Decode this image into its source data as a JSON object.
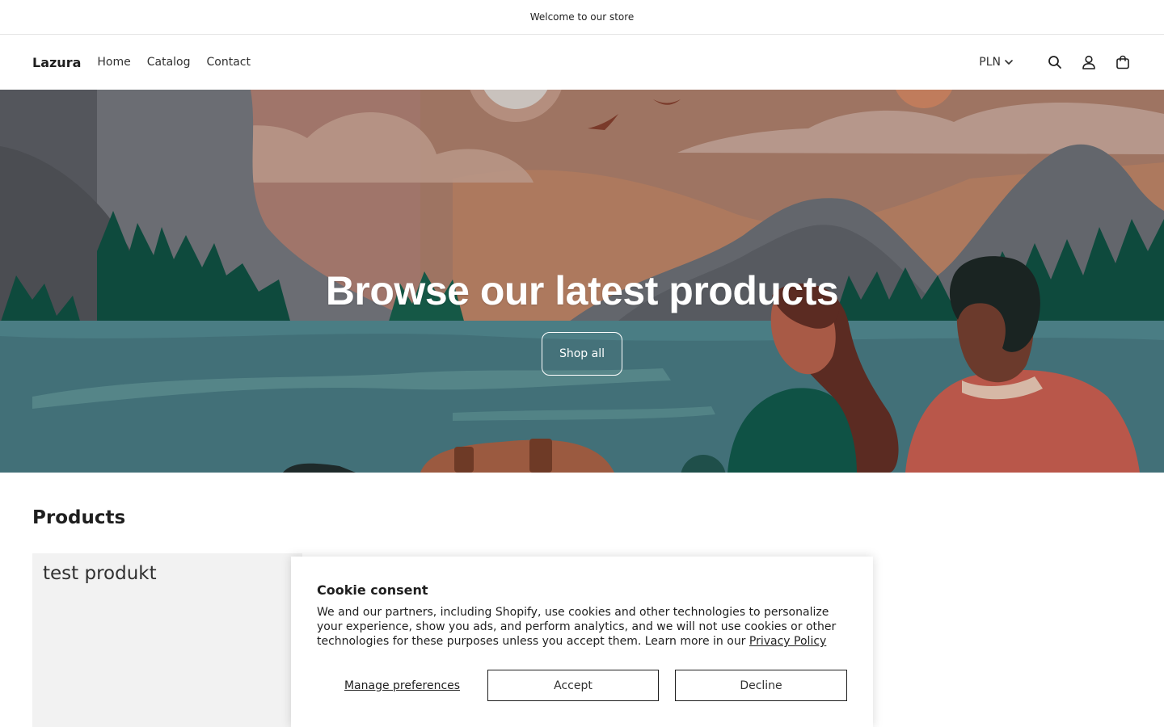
{
  "announcement": {
    "text": "Welcome to our store"
  },
  "header": {
    "logo": "Lazura",
    "nav": [
      "Home",
      "Catalog",
      "Contact"
    ],
    "currency": "PLN",
    "icons": [
      "chevron-down-icon",
      "search-icon",
      "account-icon",
      "cart-icon"
    ]
  },
  "hero": {
    "title": "Browse our latest products",
    "button": "Shop all"
  },
  "products": {
    "heading": "Products",
    "items": [
      {
        "name": "test produkt"
      }
    ]
  },
  "cookie": {
    "title": "Cookie consent",
    "text": "We and our partners, including Shopify, use cookies and other technologies to personalize your experience, show you ads, and perform analytics, and we will not use cookies or other technologies for these purposes unless you accept them. Learn more in our ",
    "link": "Privacy Policy",
    "manage": "Manage preferences",
    "accept": "Accept",
    "decline": "Decline"
  },
  "colors": {
    "text": "#303030",
    "sky": "#9a7060",
    "water": "#427078",
    "trees": "#0e4a3d",
    "cardBg": "#f2f2f2"
  }
}
